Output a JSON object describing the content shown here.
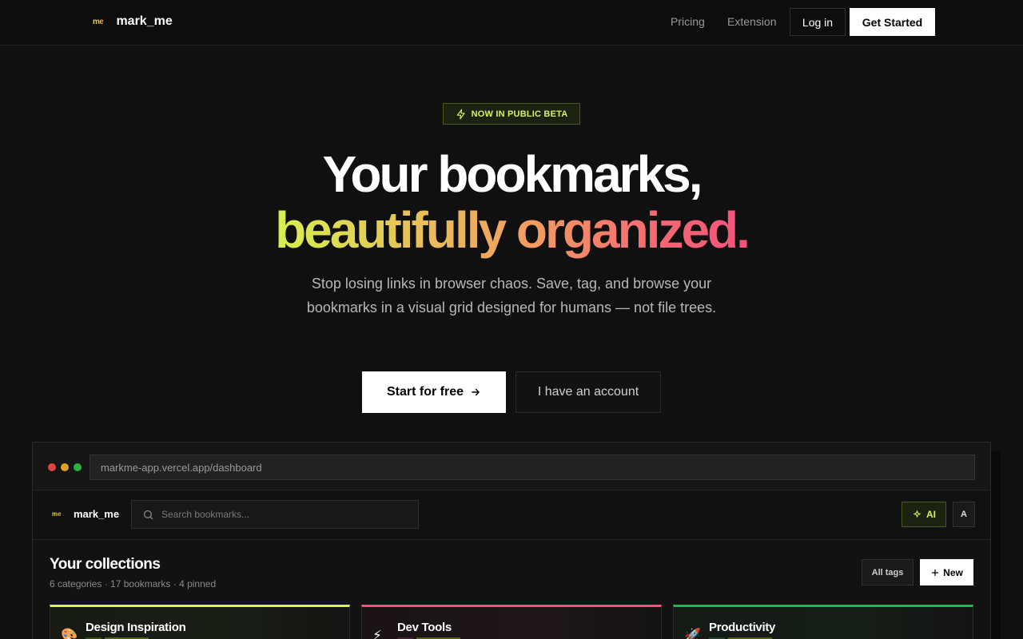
{
  "nav": {
    "logo_mark": "me",
    "logo_text": "mark_me",
    "links": [
      "Pricing",
      "Extension"
    ],
    "login_label": "Log in",
    "get_started_label": "Get Started"
  },
  "hero": {
    "badge": "NOW IN PUBLIC BETA",
    "title_line1": "Your bookmarks,",
    "title_line2": "beautifully organized.",
    "subtitle": "Stop losing links in browser chaos. Save, tag, and browse your bookmarks in a visual grid designed for humans — not file trees.",
    "cta_primary": "Start for free",
    "cta_secondary": "I have an account"
  },
  "preview": {
    "url": "markme-app.vercel.app/dashboard",
    "app": {
      "logo_mark": "me",
      "logo_text": "mark_me",
      "search_placeholder": "Search bookmarks...",
      "ai_label": "AI",
      "avatar_initial": "A"
    },
    "collections": {
      "title": "Your collections",
      "meta": "6 categories · 17 bookmarks · 4 pinned",
      "all_tags_label": "All tags",
      "new_label": "New",
      "cards": [
        {
          "icon": "🎨",
          "name": "Design Inspiration",
          "accent": "#d6f04e"
        },
        {
          "icon": "⚡",
          "name": "Dev Tools",
          "accent": "#f2527a"
        },
        {
          "icon": "🚀",
          "name": "Productivity",
          "accent": "#2bb04f"
        }
      ]
    }
  },
  "colors": {
    "background": "#101010",
    "accent_lime": "#d9ef6c",
    "gradient": [
      "#d6f04e",
      "#f29a62",
      "#f2527a"
    ]
  }
}
